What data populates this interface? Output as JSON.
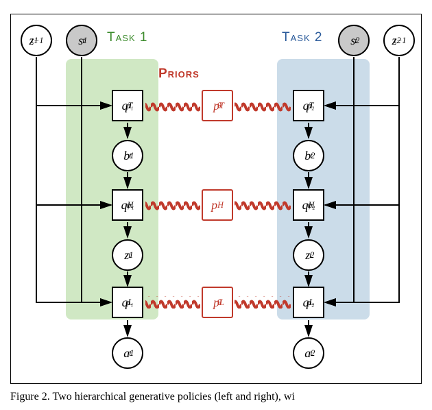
{
  "labels": {
    "task1": "Task 1",
    "task2": "Task 2",
    "priors": "Priors"
  },
  "nodes": {
    "z1_prev": "z",
    "z1_prev_sub": "t−1",
    "z1_prev_sup": "1",
    "s1": "s",
    "s1_sub": "t",
    "s1_sup": "1",
    "s2": "s",
    "s2_sub": "t",
    "s2_sup": "2",
    "z2_prev": "z",
    "z2_prev_sub": "t−1",
    "z2_prev_sup": "2",
    "qT1": "q",
    "qT1_sub": "φ₁",
    "qT1_sup": "T",
    "qT2": "q",
    "qT2_sub": "φ₂",
    "qT2_sup": "T",
    "b1": "b",
    "b1_sub": "t",
    "b1_sup": "1",
    "b2": "b",
    "b2_sub": "t",
    "b2_sup": "2",
    "qH1": "q",
    "qH1_sub": "φ₁",
    "qH1_sup": "H",
    "qH2": "q",
    "qH2_sub": "φ₂",
    "qH2_sup": "H",
    "z1": "z",
    "z1_sub": "t",
    "z1_sup": "1",
    "z2": "z",
    "z2_sub": "t",
    "z2_sup": "2",
    "qL1": "q",
    "qL1_sub": "φ₁",
    "qL1_sup": "L",
    "qL2": "q",
    "qL2_sub": "φ₂",
    "qL2_sup": "L",
    "a1": "a",
    "a1_sub": "t",
    "a1_sup": "1",
    "a2": "a",
    "a2_sub": "t",
    "a2_sup": "2",
    "pT": "p",
    "pT_sub": "θ",
    "pT_sup": "T",
    "pH": "p",
    "pH_sup": "H",
    "pL": "p",
    "pL_sub": "θ",
    "pL_sup": "L"
  },
  "caption": "Figure 2. Two hierarchical generative policies (left and right), wi"
}
